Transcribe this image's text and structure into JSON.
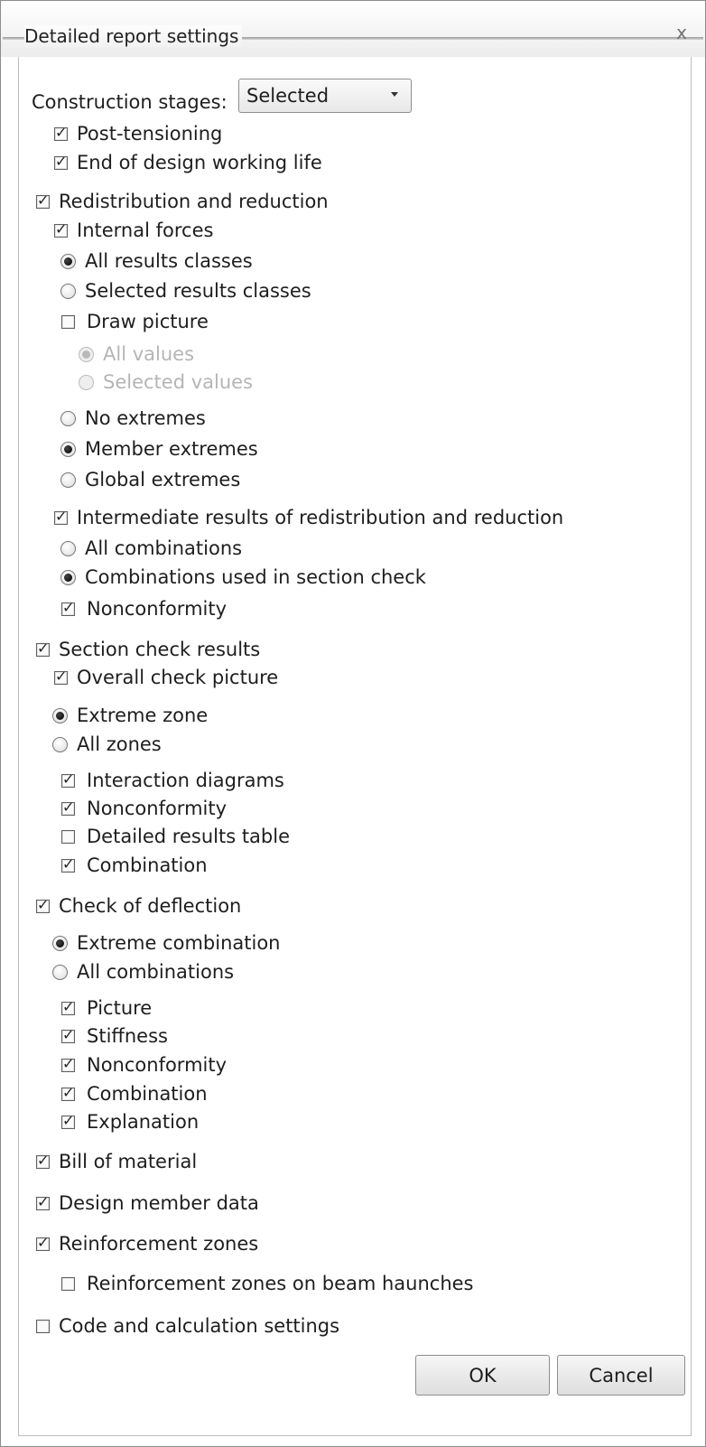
{
  "window": {
    "title": "Detailed report settings",
    "close_glyph": "x"
  },
  "construction_stages": {
    "label": "Construction stages:",
    "selected": "Selected",
    "post_tensioning": "Post-tensioning",
    "end_of_design_life": "End of design working life"
  },
  "redistribution": {
    "label": "Redistribution and reduction",
    "internal_forces": "Internal forces",
    "all_results_classes": "All results classes",
    "selected_results_classes": "Selected results classes",
    "draw_picture": "Draw picture",
    "all_values": "All values",
    "selected_values": "Selected values",
    "no_extremes": "No extremes",
    "member_extremes": "Member extremes",
    "global_extremes": "Global extremes",
    "intermediate_results": "Intermediate results of redistribution and reduction",
    "all_combinations": "All combinations",
    "combinations_used": "Combinations used in section check",
    "nonconformity": "Nonconformity"
  },
  "section_check": {
    "label": "Section check results",
    "overall_picture": "Overall check picture",
    "extreme_zone": "Extreme zone",
    "all_zones": "All zones",
    "interaction_diagrams": "Interaction diagrams",
    "nonconformity": "Nonconformity",
    "detailed_table": "Detailed results table",
    "combination": "Combination"
  },
  "deflection": {
    "label": "Check of deflection",
    "extreme_combination": "Extreme combination",
    "all_combinations": "All combinations",
    "picture": "Picture",
    "stiffness": "Stiffness",
    "nonconformity": "Nonconformity",
    "combination": "Combination",
    "explanation": "Explanation"
  },
  "bill_of_material": "Bill of material",
  "design_member_data": "Design member data",
  "reinforcement_zones": {
    "label": "Reinforcement zones",
    "on_haunches": "Reinforcement zones on beam haunches"
  },
  "code_settings": "Code and calculation settings",
  "buttons": {
    "ok": "OK",
    "cancel": "Cancel"
  }
}
